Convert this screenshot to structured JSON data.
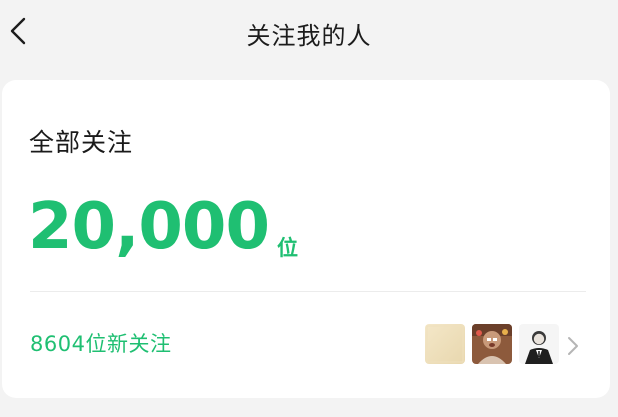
{
  "header": {
    "title": "关注我的人",
    "back_icon": "chevron-left-icon"
  },
  "summary": {
    "title": "全部关注",
    "count": "20,000",
    "unit": "位"
  },
  "new_follows": {
    "label": "8604位新关注",
    "avatars": [
      "avatar-1",
      "avatar-2",
      "avatar-3"
    ],
    "arrow_icon": "chevron-right-icon"
  },
  "colors": {
    "accent": "#1fbf72",
    "background": "#f3f3f3",
    "card": "#ffffff",
    "text": "#1a1a1a"
  }
}
